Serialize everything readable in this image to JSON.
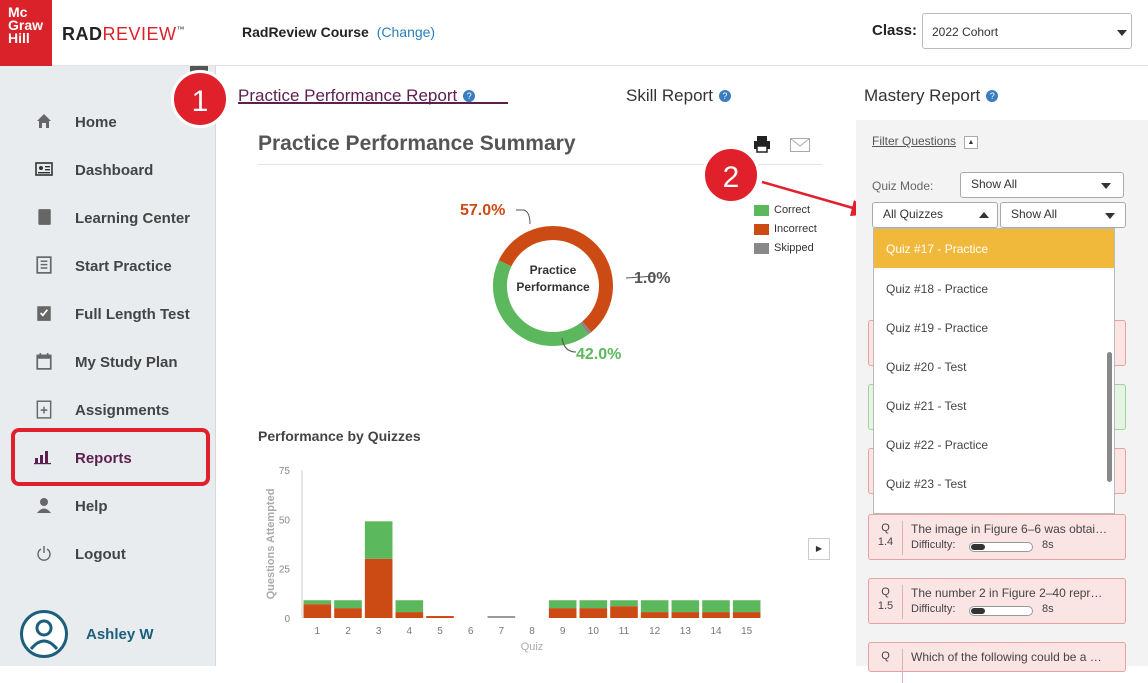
{
  "header": {
    "logo_lines": [
      "Mc",
      "Graw",
      "Hill"
    ],
    "brand_rad": "RAD",
    "brand_review": "REVIEW",
    "brand_tm": "™",
    "course_title": "RadReview Course",
    "course_change": "(Change)",
    "class_label": "Class:",
    "class_value": "2022 Cohort"
  },
  "sidebar": {
    "items": [
      {
        "label": "Home",
        "icon": "home-icon"
      },
      {
        "label": "Dashboard",
        "icon": "dashboard-icon"
      },
      {
        "label": "Learning Center",
        "icon": "book-icon"
      },
      {
        "label": "Start Practice",
        "icon": "document-icon"
      },
      {
        "label": "Full Length Test",
        "icon": "clipboard-check-icon"
      },
      {
        "label": "My Study Plan",
        "icon": "calendar-icon"
      },
      {
        "label": "Assignments",
        "icon": "clipboard-plus-icon"
      },
      {
        "label": "Reports",
        "icon": "bar-chart-icon"
      },
      {
        "label": "Help",
        "icon": "support-icon"
      },
      {
        "label": "Logout",
        "icon": "power-icon"
      }
    ],
    "user_name": "Ashley W"
  },
  "tabs": [
    {
      "label": "Practice Performance Report",
      "active": true
    },
    {
      "label": "Skill Report",
      "active": false
    },
    {
      "label": "Mastery Report",
      "active": false
    }
  ],
  "annotations": {
    "badge1": "1",
    "badge2": "2"
  },
  "summary": {
    "title": "Practice Performance Summary",
    "donut_center": [
      "Practice",
      "Performance"
    ],
    "incorrect_pct": "57.0%",
    "skipped_pct": "1.0%",
    "correct_pct": "42.0%",
    "legend": [
      {
        "label": "Correct",
        "color": "#5cb85c"
      },
      {
        "label": "Incorrect",
        "color": "#cc4b14"
      },
      {
        "label": "Skipped",
        "color": "#888888"
      }
    ],
    "colors": {
      "correct": "#5cb85c",
      "incorrect": "#cc4b14",
      "skipped": "#888888"
    }
  },
  "chart_data": {
    "type": "bar",
    "title": "Performance by Quizzes",
    "xlabel": "Quiz",
    "ylabel": "Questions Attempted",
    "categories": [
      "1",
      "2",
      "3",
      "4",
      "5",
      "6",
      "7",
      "8",
      "9",
      "10",
      "11",
      "12",
      "13",
      "14",
      "15"
    ],
    "ylim": [
      0,
      75
    ],
    "yticks": [
      0,
      25,
      50,
      75
    ],
    "series": [
      {
        "name": "Incorrect",
        "color": "#cc4b14",
        "values": [
          7,
          5,
          30,
          3,
          1,
          0,
          0,
          0,
          5,
          5,
          6,
          3,
          3,
          3,
          3
        ]
      },
      {
        "name": "Correct",
        "color": "#5cb85c",
        "values": [
          2,
          4,
          19,
          6,
          0,
          0,
          0,
          0,
          4,
          4,
          3,
          6,
          6,
          6,
          6
        ]
      },
      {
        "name": "Skipped",
        "color": "#999999",
        "values": [
          0,
          0,
          0,
          0,
          0,
          0,
          1,
          0,
          0,
          0,
          0,
          0,
          0,
          0,
          0
        ]
      }
    ],
    "grid": false,
    "legend": "none"
  },
  "filter": {
    "link": "Filter Questions",
    "toggle": "▲",
    "quiz_mode_label": "Quiz Mode:",
    "quiz_mode_value": "Show All",
    "quizzes_value": "All Quizzes",
    "show_value": "Show All",
    "options": [
      "Quiz #17 - Practice",
      "Quiz #18 - Practice",
      "Quiz #19 - Practice",
      "Quiz #20 - Test",
      "Quiz #21 - Test",
      "Quiz #22 - Practice",
      "Quiz #23 - Test"
    ],
    "selected_option": "Quiz #17 - Practice"
  },
  "questions": [
    {
      "q": "Q",
      "num": "1.4",
      "text": "The image in Figure 6–6 was obtai…",
      "difficulty_label": "Difficulty:",
      "time": "8s",
      "status": "incorrect"
    },
    {
      "q": "Q",
      "num": "1.5",
      "text": "The number 2 in Figure 2–40 repr…",
      "difficulty_label": "Difficulty:",
      "time": "8s",
      "status": "incorrect"
    },
    {
      "q": "Q",
      "num": "",
      "text": "Which of the following could be a …",
      "difficulty_label": "",
      "time": "",
      "status": "incorrect"
    }
  ]
}
